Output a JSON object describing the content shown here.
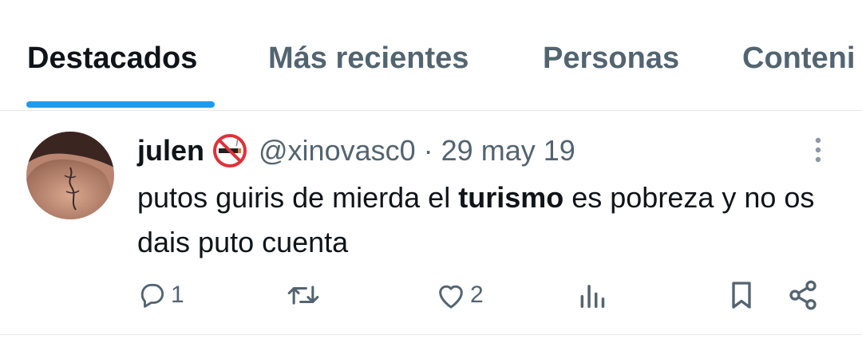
{
  "tabs": [
    {
      "label": "Destacados",
      "active": true
    },
    {
      "label": "Más recientes",
      "active": false
    },
    {
      "label": "Personas",
      "active": false
    },
    {
      "label": "Conteni",
      "active": false
    }
  ],
  "tweet": {
    "author_name": "julen",
    "badge_icon": "no-smoking-icon",
    "handle": "@xinovasc0",
    "separator": "·",
    "date": "29 may 19",
    "text_before": "putos guiris de mierda el ",
    "text_bold": "turismo",
    "text_after": " es pobreza y no os dais puto cuenta",
    "replies": "1",
    "retweets": "",
    "likes": "2"
  },
  "colors": {
    "accent": "#1d9bf0",
    "text_primary": "#0f1419",
    "text_secondary": "#536471",
    "border": "#e6e9eb"
  }
}
